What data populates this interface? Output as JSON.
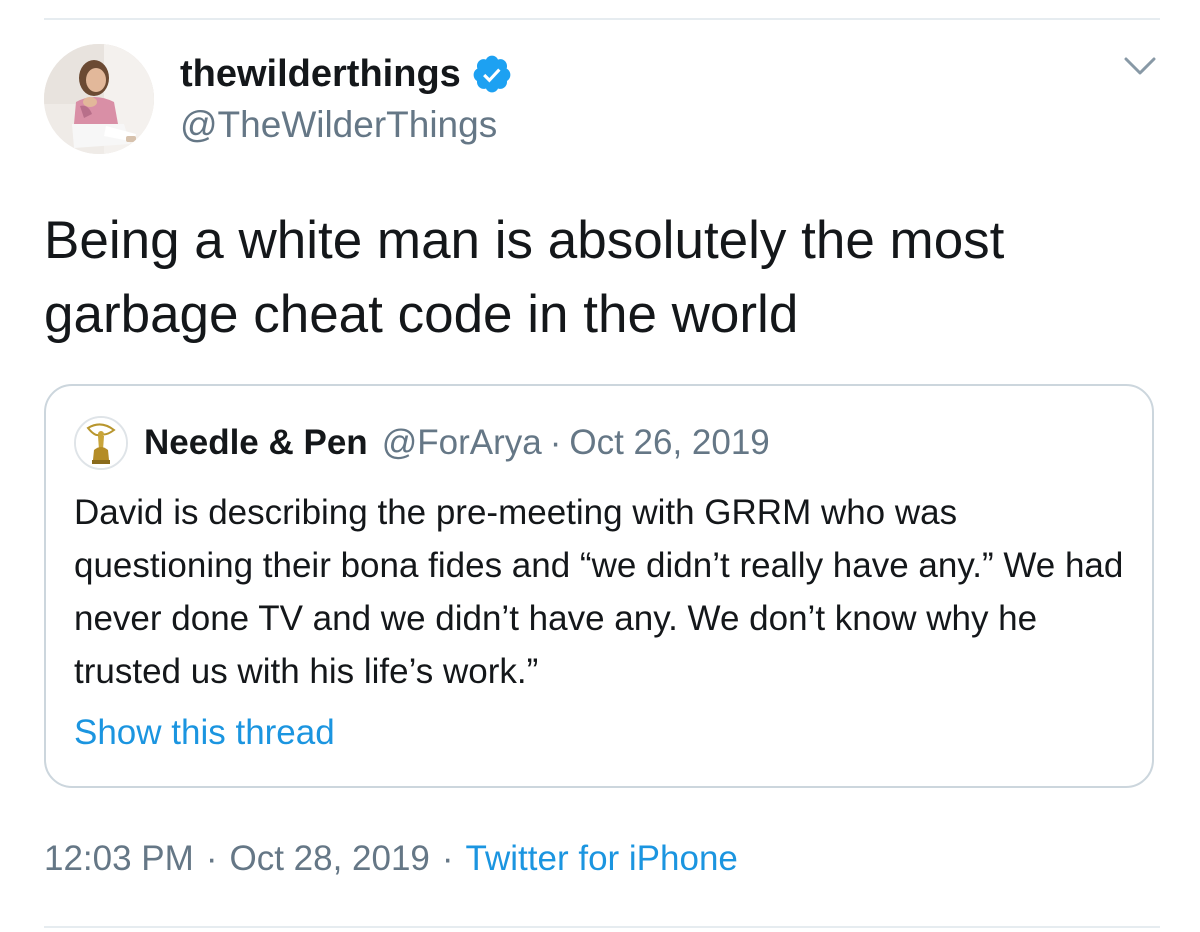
{
  "tweet": {
    "author": {
      "display_name": "thewilderthings",
      "handle": "@TheWilderThings",
      "verified": true,
      "avatar_icon": "profile-photo"
    },
    "text": "Being a white man is absolutely the most garbage cheat code in the world",
    "menu_icon": "chevron-down-icon",
    "quoted_tweet": {
      "author_name": "Needle & Pen",
      "author_handle": "@ForArya",
      "separator": "·",
      "date": "Oct 26, 2019",
      "avatar_icon": "emmy-award-icon",
      "text": "David is describing the pre-meeting with GRRM who was questioning their bona fides and “we didn’t really have any.” We had never done TV and we didn’t have any. We don’t know why he trusted us with his life’s work.”",
      "show_thread_label": "Show this thread"
    },
    "timestamp": {
      "time": "12:03 PM",
      "separator_1": "·",
      "date": "Oct 28, 2019",
      "separator_2": "·",
      "source": "Twitter for iPhone"
    }
  },
  "colors": {
    "text_primary": "#14171a",
    "text_secondary": "#657786",
    "link": "#1b95e0",
    "verified_badge": "#1da1f2",
    "border": "#ccd6dd"
  }
}
